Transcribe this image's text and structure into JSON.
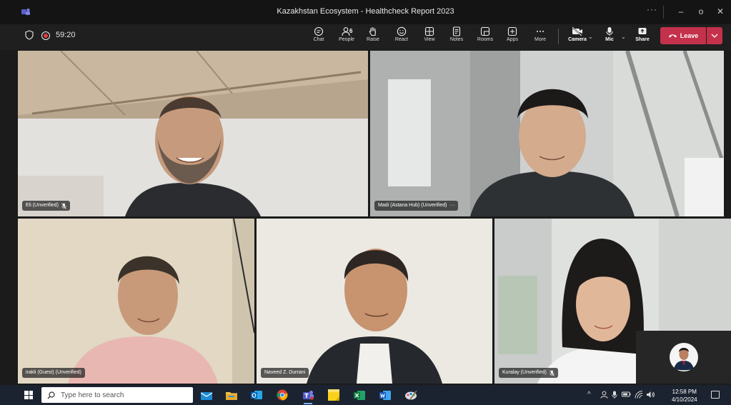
{
  "window": {
    "title": "Kazakhstan Ecosystem - Healthcheck Report 2023",
    "more": "···",
    "minimize": "–",
    "maximize": "o",
    "close": "✕"
  },
  "meeting": {
    "timer": "59:20",
    "recording": true,
    "toolbar": [
      {
        "id": "chat",
        "label": "Chat",
        "icon": "chat-icon"
      },
      {
        "id": "people",
        "label": "People",
        "icon": "people-icon",
        "count": "6"
      },
      {
        "id": "raise",
        "label": "Raise",
        "icon": "hand-icon"
      },
      {
        "id": "react",
        "label": "React",
        "icon": "smiley-icon"
      },
      {
        "id": "view",
        "label": "View",
        "icon": "grid-icon"
      },
      {
        "id": "notes",
        "label": "Notes",
        "icon": "notes-icon"
      },
      {
        "id": "rooms",
        "label": "Rooms",
        "icon": "rooms-icon"
      },
      {
        "id": "apps",
        "label": "Apps",
        "icon": "plus-icon"
      },
      {
        "id": "more",
        "label": "More",
        "icon": "more-icon"
      }
    ],
    "camera_label": "Camera",
    "mic_label": "Mic",
    "share_label": "Share",
    "leave_label": "Leave",
    "leave_color": "#c4314b"
  },
  "participants": [
    {
      "name": "Eli (Unverified)",
      "muted": true
    },
    {
      "name": "Madi (Astana Hub) (Unverified)",
      "more": "···"
    },
    {
      "name": "irakli (Guest) (Unverified)"
    },
    {
      "name": "Naveed Z. Durrani"
    },
    {
      "name": "Kuralay (Unverified)",
      "muted": true
    }
  ],
  "taskbar": {
    "search_placeholder": "Type here to search",
    "clock_time": "12:58 PM",
    "clock_date": "4/10/2024",
    "apps": [
      "mail-icon",
      "file-explorer-icon",
      "outlook-icon",
      "chrome-icon",
      "teams-icon",
      "sticky-notes-icon",
      "excel-icon",
      "word-icon",
      "paint-icon"
    ]
  }
}
